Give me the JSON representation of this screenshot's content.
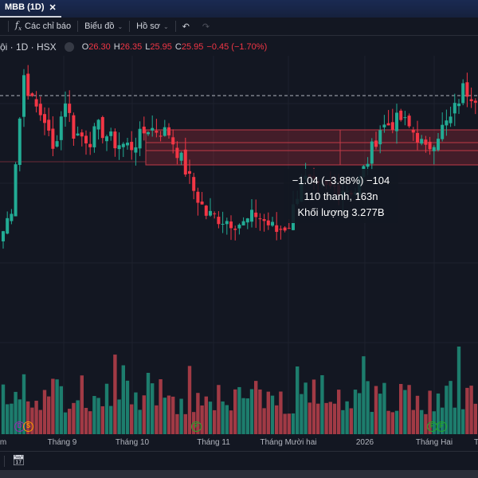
{
  "tab": {
    "title": "MBB (1D)",
    "close": "✕"
  },
  "toolbar": {
    "indicators": "Các chỉ báo",
    "chart": "Biểu đồ",
    "profile": "Hồ sơ"
  },
  "legend": {
    "symbol": "ội · 1D · HSX",
    "o_label": "O",
    "o": "26.30",
    "h_label": "H",
    "h": "26.35",
    "l_label": "L",
    "l": "25.95",
    "c_label": "C",
    "c": "25.95",
    "change": "−0.45 (−1.70%)"
  },
  "tooltip": {
    "line1": "−1.04 (−3.88%) −104",
    "line2": "110 thanh, 163n",
    "line3": "Khối lượng 3.277B"
  },
  "time_axis": [
    {
      "label": "m"
    },
    {
      "label": "Tháng 9"
    },
    {
      "label": "Tháng 10"
    },
    {
      "label": "Tháng 11"
    },
    {
      "label": "Tháng Mười hai"
    },
    {
      "label": "2026"
    },
    {
      "label": "Tháng Hai"
    },
    {
      "label": "T"
    }
  ],
  "events": [
    {
      "label": "D",
      "color": "#9c27b0"
    },
    {
      "label": "S",
      "color": "#ff9800"
    },
    {
      "label": "F",
      "color": "#22ab2a"
    },
    {
      "label": "F",
      "color": "#22ab2a"
    },
    {
      "label": "F",
      "color": "#22ab2a"
    }
  ],
  "colors": {
    "up": "#22ab94",
    "down": "#f23645",
    "up_vol": "#1d7d6d",
    "down_vol": "#a13a45"
  },
  "chart_data": {
    "type": "candlestick",
    "price_range": [
      22.0,
      29.0
    ],
    "dashed_level": 28.0,
    "zone": [
      26.0,
      26.8
    ],
    "waypoints": [
      [
        0,
        24.0
      ],
      [
        2,
        24.7
      ],
      [
        3,
        26.1
      ],
      [
        5,
        28.6
      ],
      [
        7,
        27.8
      ],
      [
        10,
        27.3
      ],
      [
        12,
        26.35
      ],
      [
        15,
        27.9
      ],
      [
        17,
        26.9
      ],
      [
        21,
        26.7
      ],
      [
        23,
        27.05
      ],
      [
        27,
        26.6
      ],
      [
        31,
        26.5
      ],
      [
        35,
        27.05
      ],
      [
        40,
        26.9
      ],
      [
        43,
        26.1
      ],
      [
        46,
        25.2
      ],
      [
        49,
        24.5
      ],
      [
        53,
        24.35
      ],
      [
        58,
        24.2
      ],
      [
        61,
        24.5
      ],
      [
        66,
        24.0
      ],
      [
        69,
        24.2
      ],
      [
        72,
        25.6
      ],
      [
        76,
        25.2
      ],
      [
        81,
        25.3
      ],
      [
        85,
        25.2
      ],
      [
        88,
        26.1
      ],
      [
        91,
        27.05
      ],
      [
        96,
        27.3
      ],
      [
        100,
        26.8
      ],
      [
        102,
        26.35
      ],
      [
        105,
        26.9
      ],
      [
        108,
        27.3
      ],
      [
        111,
        28.2
      ],
      [
        114,
        28.0
      ]
    ]
  }
}
